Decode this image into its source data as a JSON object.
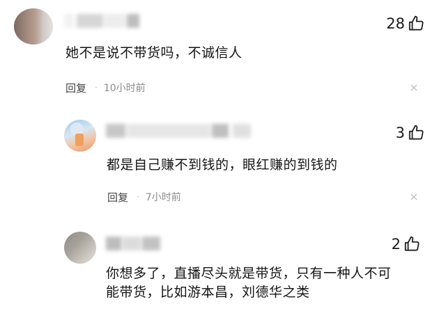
{
  "comments": [
    {
      "likes": "28",
      "text": "她不是说不带货吗，不诚信人",
      "reply_label": "回复",
      "separator": "·",
      "time": "10小时前"
    },
    {
      "likes": "3",
      "text": "都是自己赚不到钱的，眼红赚的到钱的",
      "reply_label": "回复",
      "separator": "·",
      "time": "7小时前"
    },
    {
      "likes": "2",
      "text_lines": [
        "你想多了，直播尽头就是带货，只有一种人不可",
        "能带货，比如游本昌，刘德华之类"
      ]
    }
  ],
  "icons": {
    "like": "thumbs-up-outline-icon",
    "close": "x-close-icon"
  }
}
